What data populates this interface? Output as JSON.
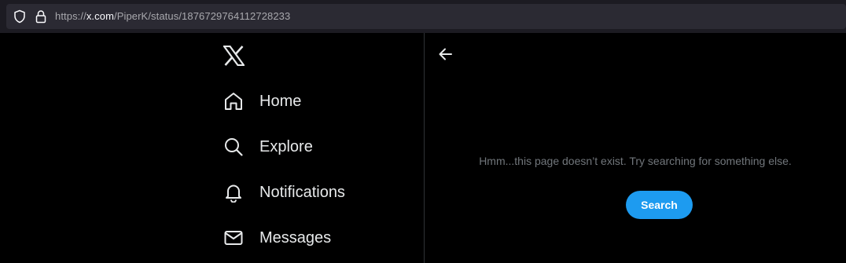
{
  "browser": {
    "url_prefix": "https://",
    "url_host": "x.com",
    "url_path": "/PiperK/status/1876729764112728233"
  },
  "sidebar": {
    "logo_icon": "x-logo-icon",
    "items": [
      {
        "label": "Home",
        "icon": "home-icon"
      },
      {
        "label": "Explore",
        "icon": "search-icon"
      },
      {
        "label": "Notifications",
        "icon": "bell-icon"
      },
      {
        "label": "Messages",
        "icon": "envelope-icon"
      }
    ]
  },
  "main": {
    "back_icon": "arrow-left-icon",
    "message": "Hmm...this page doesn’t exist. Try searching for something else.",
    "search_button_label": "Search"
  },
  "colors": {
    "background": "#000000",
    "accent": "#1d9bf0",
    "text_primary": "#e7e9ea",
    "text_secondary": "#71767b",
    "divider": "#2f3336"
  }
}
